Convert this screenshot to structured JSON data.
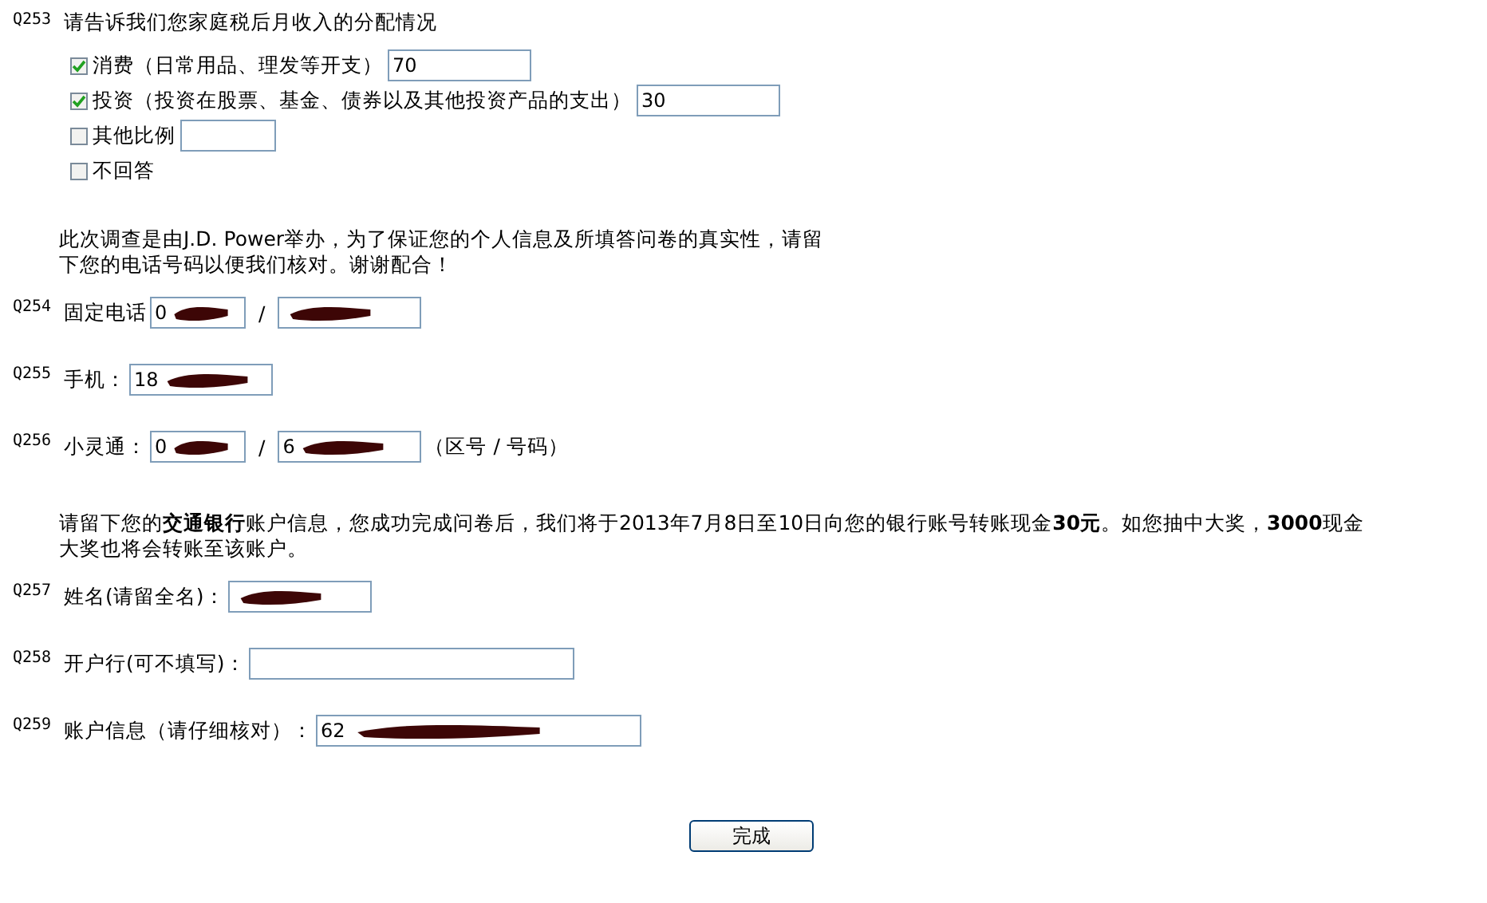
{
  "questions": [
    {
      "kind": "choice",
      "number": "Q253",
      "text": "请告诉我们您家庭税后月收入的分配情况",
      "options": [
        {
          "label": "消费（日常用品、理发等开支）",
          "checked": true,
          "kind": "with-field",
          "value": "70"
        },
        {
          "label": "投资（投资在股票、基金、债券以及其他投资产品的支出）",
          "checked": true,
          "kind": "with-field",
          "value": "30"
        },
        {
          "label": "其他比例",
          "checked": false,
          "kind": "with-field"
        },
        {
          "label": "不回答",
          "checked": false,
          "kind": "plain"
        }
      ]
    },
    {
      "kind": "note",
      "lines": [
        "此次调查是由J.D. Power举办，为了保证您的个人信息及所填答问卷的真实性，请留",
        "下您的电话号码以便我们核对。谢谢配合！"
      ]
    },
    {
      "kind": "fields",
      "number": "Q254",
      "parts": [
        {
          "kind": "label",
          "text": "固定电话"
        },
        {
          "kind": "code-field",
          "value": "0",
          "redacted": true
        },
        {
          "kind": "label",
          "text": "/"
        },
        {
          "kind": "short-field",
          "redacted": true
        }
      ]
    },
    {
      "kind": "fields",
      "number": "Q255",
      "parts": [
        {
          "kind": "label",
          "text": "手机："
        },
        {
          "kind": "short-field",
          "value": "18",
          "redacted": true
        }
      ]
    },
    {
      "kind": "fields",
      "number": "Q256",
      "parts": [
        {
          "kind": "label",
          "text": "小灵通："
        },
        {
          "kind": "code-field",
          "value": "0",
          "redacted": true
        },
        {
          "kind": "label",
          "text": "/"
        },
        {
          "kind": "short-field",
          "value": "6",
          "redacted": true
        },
        {
          "kind": "label",
          "text": "（区号 / 号码）"
        }
      ]
    },
    {
      "kind": "note",
      "lines": [
        "请留下您的**交通银行**账户信息，您成功完成问卷后，我们将于2013年7月8日至10日向您的银行账号转账现金**30元**。如您抽中大奖，**3000**现金",
        "大奖也将会转账至该账户。"
      ]
    },
    {
      "kind": "fields",
      "number": "Q257",
      "parts": [
        {
          "kind": "label",
          "text": "姓名(请留全名)："
        },
        {
          "kind": "short-field",
          "redacted": true
        }
      ]
    },
    {
      "kind": "fields",
      "number": "Q258",
      "parts": [
        {
          "kind": "label",
          "text": "开户行(可不填写)："
        },
        {
          "kind": "long-field",
          "redacted": false
        }
      ]
    },
    {
      "kind": "fields",
      "number": "Q259",
      "parts": [
        {
          "kind": "label",
          "text": "账户信息（请仔细核对）："
        },
        {
          "kind": "long-field",
          "value": "62",
          "redacted": true
        }
      ]
    }
  ],
  "submit": "完成"
}
